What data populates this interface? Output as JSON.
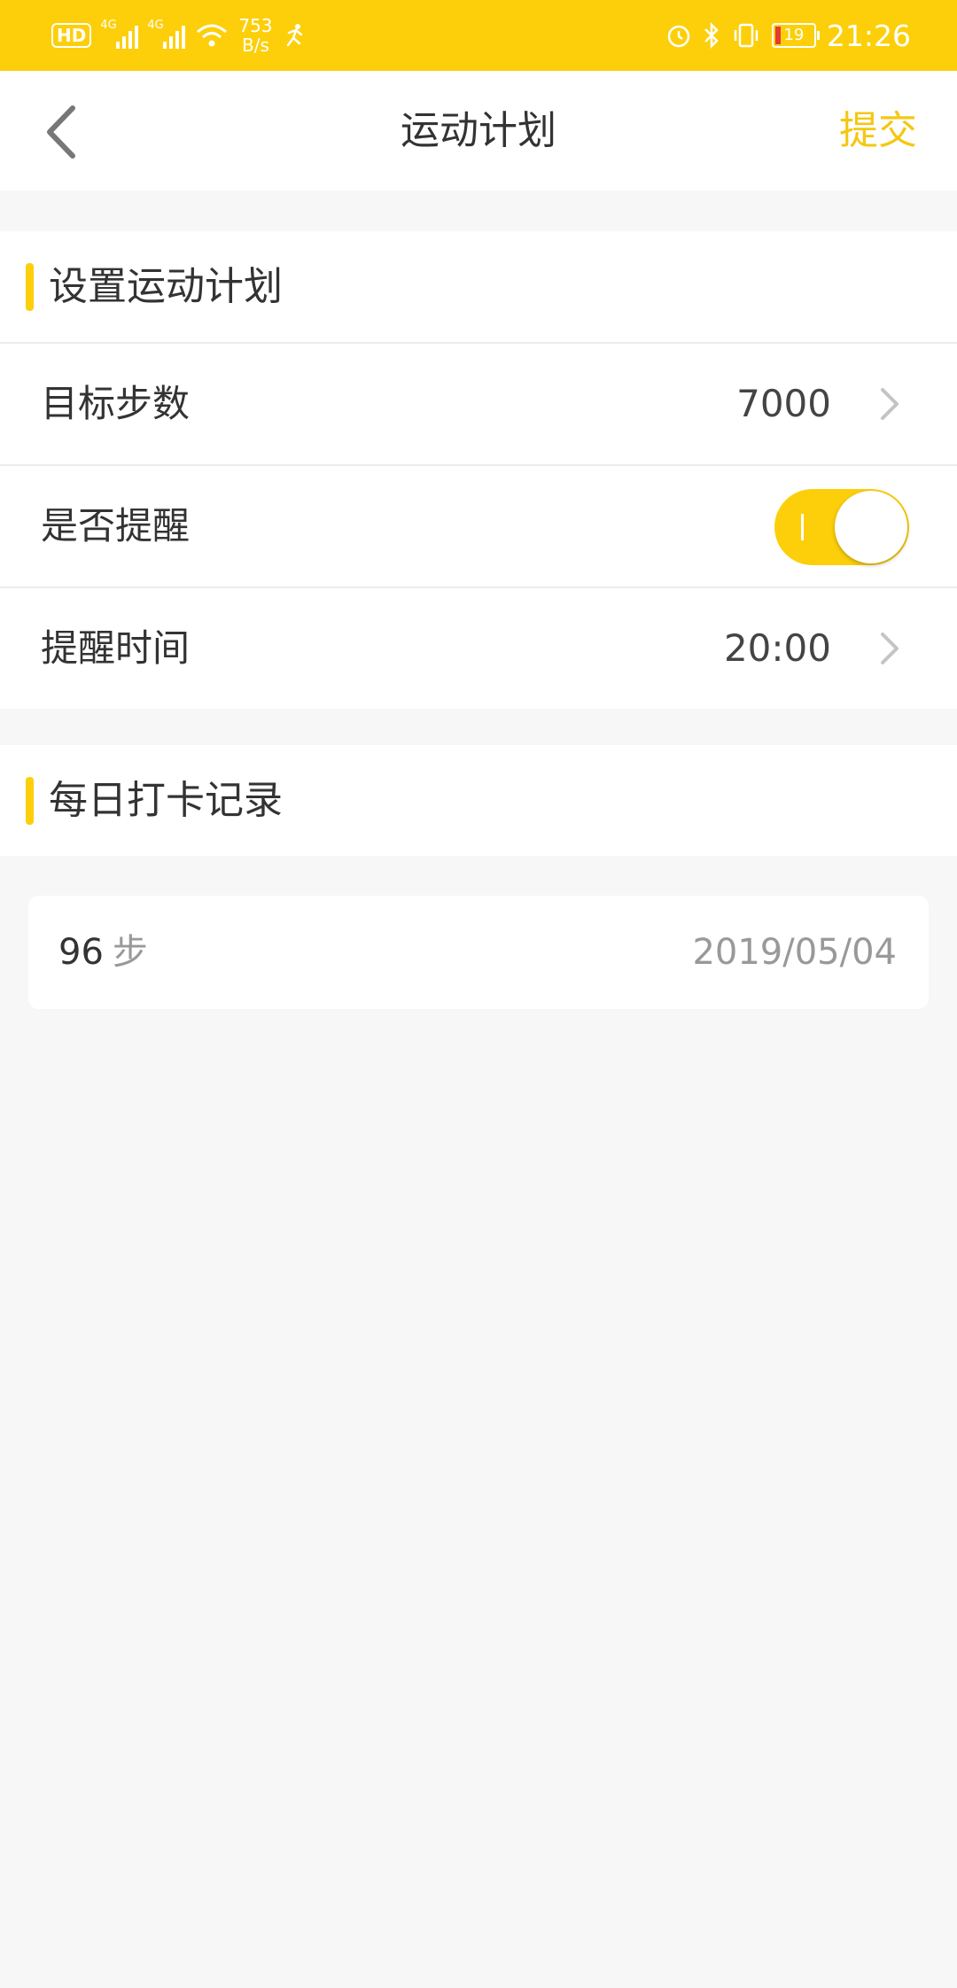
{
  "status_bar": {
    "hd": "HD",
    "net1": "4G",
    "net2": "4G",
    "speed_value": "753",
    "speed_unit": "B/s",
    "battery": "19",
    "time": "21:26"
  },
  "header": {
    "title": "运动计划",
    "submit_label": "提交"
  },
  "plan": {
    "section_title": "设置运动计划",
    "target_steps_label": "目标步数",
    "target_steps_value": "7000",
    "reminder_label": "是否提醒",
    "reminder_on": true,
    "reminder_time_label": "提醒时间",
    "reminder_time_value": "20:00"
  },
  "records": {
    "section_title": "每日打卡记录",
    "items": [
      {
        "steps": "96",
        "unit": "步",
        "date": "2019/05/04"
      }
    ]
  },
  "colors": {
    "accent": "#FCCF0A",
    "accent_text": "#F5C711"
  }
}
